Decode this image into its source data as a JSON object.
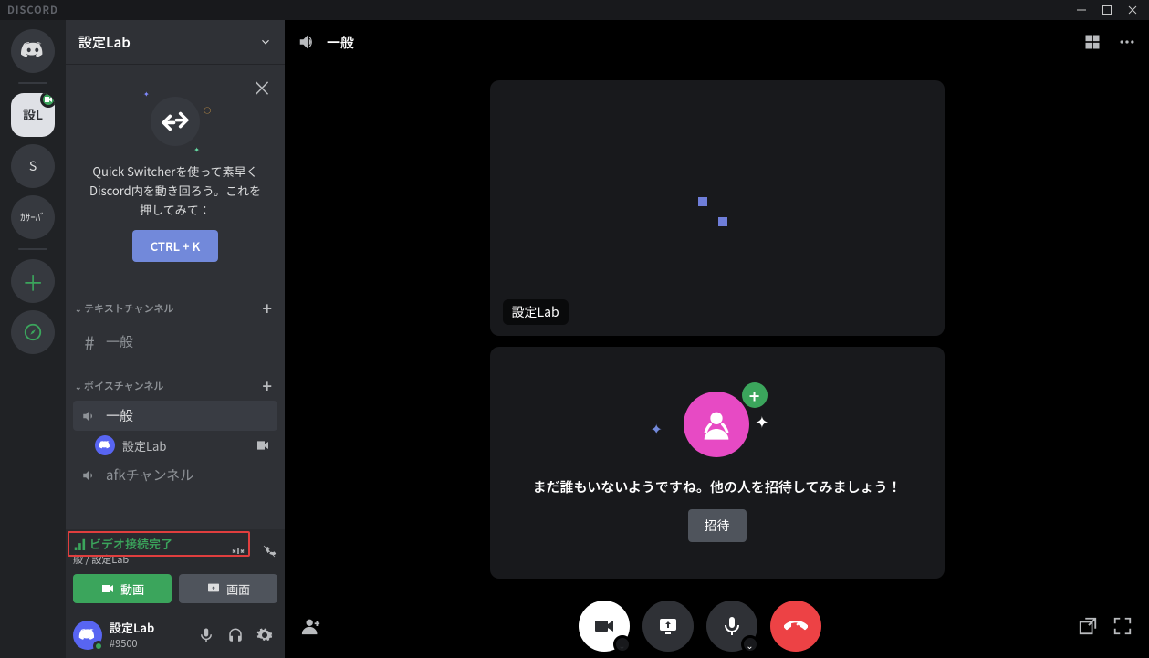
{
  "app": {
    "name": "DISCORD"
  },
  "servers": {
    "selected_label": "設L",
    "other_label": "S",
    "find_label": "ｶｻｰﾊﾞ"
  },
  "guild": {
    "name": "設定Lab"
  },
  "quickswitch": {
    "text": "Quick Switcherを使って素早くDiscord内を動き回ろう。これを押してみて：",
    "key": "CTRL + K"
  },
  "categories": {
    "text": "テキストチャンネル",
    "voice": "ボイスチャンネル"
  },
  "channels": {
    "general_text": "一般",
    "general_voice": "一般",
    "participant": "設定Lab",
    "afk": "afkチャンネル"
  },
  "voice_status": {
    "label": "ビデオ接続完了",
    "sub": "般 / 設定Lab",
    "btn_video": "動画",
    "btn_screen": "画面"
  },
  "user": {
    "name": "設定Lab",
    "tag": "#9500"
  },
  "call": {
    "channel": "一般",
    "tile_label": "設定Lab",
    "empty_msg": "まだ誰もいないようですね。他の人を招待してみましょう！",
    "invite_btn": "招待"
  }
}
